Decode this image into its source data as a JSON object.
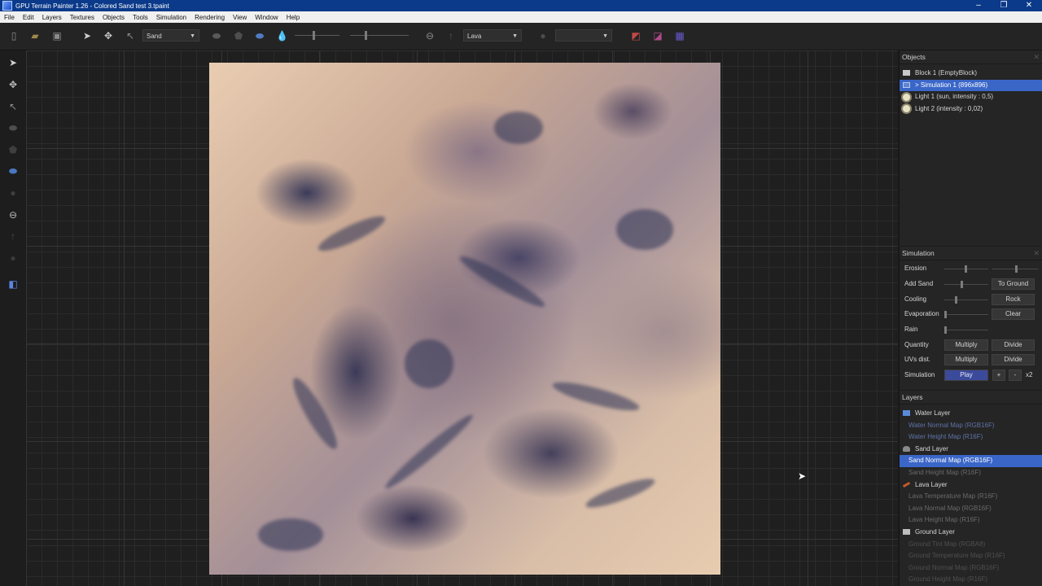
{
  "titlebar": {
    "title": "GPU Terrain Painter 1.26 - Colored Sand test 3.tpaint",
    "minimize": "–",
    "maximize": "❐",
    "close": "✕"
  },
  "menu": [
    "File",
    "Edit",
    "Layers",
    "Textures",
    "Objects",
    "Tools",
    "Simulation",
    "Rendering",
    "View",
    "Window",
    "Help"
  ],
  "toolbar": {
    "brush_combo": "Sand",
    "material_combo": "Lava",
    "color_combo": ""
  },
  "objects_panel": {
    "title": "Objects",
    "items": [
      {
        "label": "Block 1 (EmptyBlock)",
        "icon": "block-icon",
        "selected": false
      },
      {
        "label": "> Simulation 1 (896x896)",
        "icon": "simulation-icon",
        "selected": true
      },
      {
        "label": "Light 1 (sun, intensity : 0,5)",
        "icon": "sun-icon",
        "selected": false
      },
      {
        "label": "Light 2 (intensity : 0,02)",
        "icon": "sun-icon",
        "selected": false
      }
    ]
  },
  "simulation_panel": {
    "title": "Simulation",
    "erosion": "Erosion",
    "add_sand": "Add Sand",
    "cooling": "Cooling",
    "evaporation": "Evaporation",
    "rain": "Rain",
    "quantity": "Quantity",
    "uvs_dist": "UVs dist.",
    "simulation": "Simulation",
    "to_ground": "To Ground",
    "rock": "Rock",
    "clear": "Clear",
    "multiply": "Multiply",
    "divide": "Divide",
    "play": "Play",
    "plus": "+",
    "minus": "-",
    "speed": "x2"
  },
  "layers_panel": {
    "title": "Layers",
    "water_layer": "Water Layer",
    "water_normal": "Water Normal Map (RGB16F)",
    "water_height": "Water Height Map (R16F)",
    "sand_layer": "Sand Layer",
    "sand_normal": "Sand Normal Map (RGB16F)",
    "sand_height": "Sand Height Map (R16F)",
    "lava_layer": "Lava Layer",
    "lava_temp": "Lava Temperature Map (R16F)",
    "lava_normal": "Lava Normal Map (RGB16F)",
    "lava_height": "Lava Height Map (R16F)",
    "ground_layer": "Ground Layer",
    "ground_tint": "Ground Tint Map (RGBA8)",
    "ground_temp": "Ground Temperature Map (R16F)",
    "ground_normal": "Ground Normal Map (RGB16F)",
    "ground_height": "Ground Height Map (R16F)"
  },
  "colors": {
    "title_bar": "#0b3a8a",
    "selection": "#3a66c8",
    "panel_bg": "#252525"
  }
}
